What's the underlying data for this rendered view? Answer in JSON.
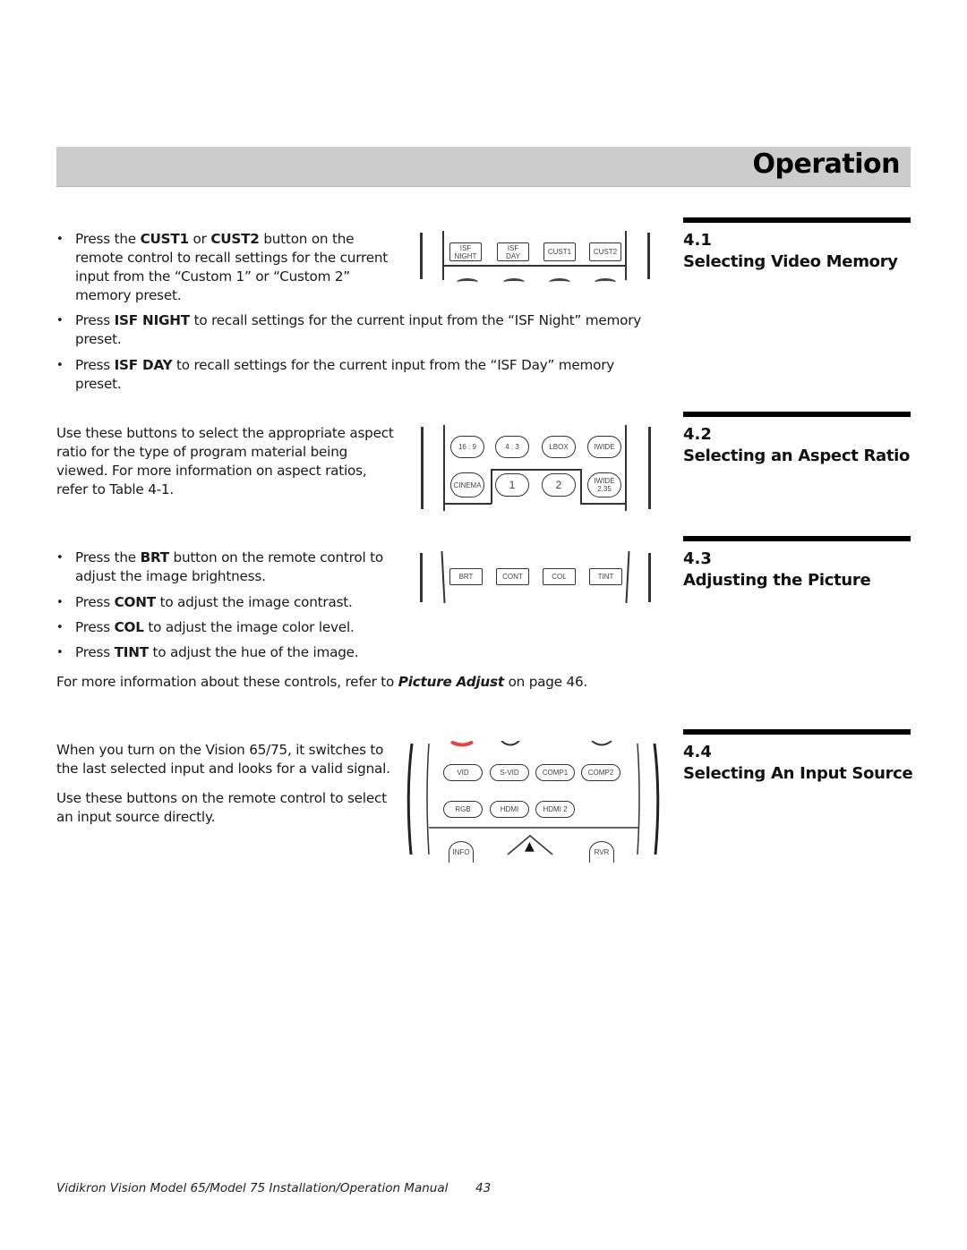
{
  "header": {
    "title": "Operation"
  },
  "sections": [
    {
      "number": "4.1",
      "title": "Selecting Video Memory",
      "bullets": [
        {
          "pre": "Press the ",
          "b1": "CUST1",
          "mid": " or ",
          "b2": "CUST2",
          "post": " button on the remote control to recall settings for the current input from the “Custom 1” or “Custom 2” memory preset."
        },
        {
          "pre": "Press ",
          "b1": "ISF NIGHT",
          "post": " to recall settings for the current input from the “ISF Night” memory preset."
        },
        {
          "pre": "Press ",
          "b1": "ISF DAY",
          "post": " to recall settings for the current input from the “ISF Day” memory preset."
        }
      ],
      "remote_buttons": [
        {
          "line1": "ISF",
          "line2": "NIGHT"
        },
        {
          "line1": "ISF",
          "line2": "DAY"
        },
        {
          "line1": "CUST1"
        },
        {
          "line1": "CUST2"
        }
      ]
    },
    {
      "number": "4.2",
      "title": "Selecting an Aspect Ratio",
      "paragraph": "Use these buttons to select the appropriate aspect ratio for the type of program material being viewed. For more information on aspect ratios, refer to Table 4-1.",
      "remote_buttons": [
        {
          "line1": "16 : 9"
        },
        {
          "line1": "4 : 3"
        },
        {
          "line1": "LBOX"
        },
        {
          "line1": "IWIDE"
        },
        {
          "line1": "CINEMA"
        },
        {
          "line1": "1"
        },
        {
          "line1": "2"
        },
        {
          "line1": "IWIDE",
          "line2": "2.35"
        }
      ]
    },
    {
      "number": "4.3",
      "title": "Adjusting the Picture",
      "bullets": [
        {
          "pre": "Press the ",
          "b1": "BRT",
          "post": " button on the remote control to adjust the image brightness."
        },
        {
          "pre": "Press ",
          "b1": "CONT",
          "post": " to adjust the image contrast."
        },
        {
          "pre": "Press ",
          "b1": "COL",
          "post": " to adjust the image color level."
        },
        {
          "pre": "Press ",
          "b1": "TINT",
          "post": " to adjust the hue of the image."
        }
      ],
      "note": {
        "pre": "For more information about these controls, refer to ",
        "link": "Picture Adjust",
        "post": " on page 46."
      },
      "remote_buttons": [
        {
          "line1": "BRT"
        },
        {
          "line1": "CONT"
        },
        {
          "line1": "COL"
        },
        {
          "line1": "TINT"
        }
      ]
    },
    {
      "number": "4.4",
      "title": "Selecting An Input Source",
      "paragraphs": [
        "When you turn on the Vision 65/75, it switches to the last selected input and looks for a valid signal.",
        "Use these buttons on the remote control to select an input source directly."
      ],
      "remote_buttons": [
        {
          "line1": "VID"
        },
        {
          "line1": "S-VID"
        },
        {
          "line1": "COMP1"
        },
        {
          "line1": "COMP2"
        },
        {
          "line1": "RGB"
        },
        {
          "line1": "HDMI"
        },
        {
          "line1": "HDMI 2"
        },
        {
          "line1": "INFO"
        },
        {
          "line1": "RVR"
        }
      ],
      "icons": {
        "up_arrow": "▲"
      }
    }
  ],
  "footer": {
    "text": "Vidikron Vision Model 65/Model 75 Installation/Operation Manual",
    "page": "43"
  }
}
